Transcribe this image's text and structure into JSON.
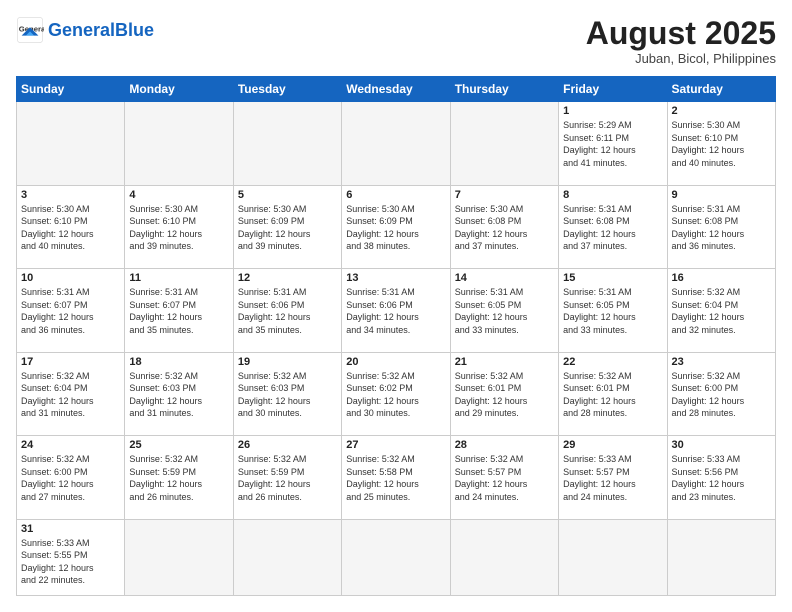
{
  "logo": {
    "text_general": "General",
    "text_blue": "Blue"
  },
  "header": {
    "month": "August 2025",
    "location": "Juban, Bicol, Philippines"
  },
  "weekdays": [
    "Sunday",
    "Monday",
    "Tuesday",
    "Wednesday",
    "Thursday",
    "Friday",
    "Saturday"
  ],
  "weeks": [
    [
      {
        "day": "",
        "info": "",
        "empty": true
      },
      {
        "day": "",
        "info": "",
        "empty": true
      },
      {
        "day": "",
        "info": "",
        "empty": true
      },
      {
        "day": "",
        "info": "",
        "empty": true
      },
      {
        "day": "",
        "info": "",
        "empty": true
      },
      {
        "day": "1",
        "info": "Sunrise: 5:29 AM\nSunset: 6:11 PM\nDaylight: 12 hours\nand 41 minutes."
      },
      {
        "day": "2",
        "info": "Sunrise: 5:30 AM\nSunset: 6:10 PM\nDaylight: 12 hours\nand 40 minutes."
      }
    ],
    [
      {
        "day": "3",
        "info": "Sunrise: 5:30 AM\nSunset: 6:10 PM\nDaylight: 12 hours\nand 40 minutes."
      },
      {
        "day": "4",
        "info": "Sunrise: 5:30 AM\nSunset: 6:10 PM\nDaylight: 12 hours\nand 39 minutes."
      },
      {
        "day": "5",
        "info": "Sunrise: 5:30 AM\nSunset: 6:09 PM\nDaylight: 12 hours\nand 39 minutes."
      },
      {
        "day": "6",
        "info": "Sunrise: 5:30 AM\nSunset: 6:09 PM\nDaylight: 12 hours\nand 38 minutes."
      },
      {
        "day": "7",
        "info": "Sunrise: 5:30 AM\nSunset: 6:08 PM\nDaylight: 12 hours\nand 37 minutes."
      },
      {
        "day": "8",
        "info": "Sunrise: 5:31 AM\nSunset: 6:08 PM\nDaylight: 12 hours\nand 37 minutes."
      },
      {
        "day": "9",
        "info": "Sunrise: 5:31 AM\nSunset: 6:08 PM\nDaylight: 12 hours\nand 36 minutes."
      }
    ],
    [
      {
        "day": "10",
        "info": "Sunrise: 5:31 AM\nSunset: 6:07 PM\nDaylight: 12 hours\nand 36 minutes."
      },
      {
        "day": "11",
        "info": "Sunrise: 5:31 AM\nSunset: 6:07 PM\nDaylight: 12 hours\nand 35 minutes."
      },
      {
        "day": "12",
        "info": "Sunrise: 5:31 AM\nSunset: 6:06 PM\nDaylight: 12 hours\nand 35 minutes."
      },
      {
        "day": "13",
        "info": "Sunrise: 5:31 AM\nSunset: 6:06 PM\nDaylight: 12 hours\nand 34 minutes."
      },
      {
        "day": "14",
        "info": "Sunrise: 5:31 AM\nSunset: 6:05 PM\nDaylight: 12 hours\nand 33 minutes."
      },
      {
        "day": "15",
        "info": "Sunrise: 5:31 AM\nSunset: 6:05 PM\nDaylight: 12 hours\nand 33 minutes."
      },
      {
        "day": "16",
        "info": "Sunrise: 5:32 AM\nSunset: 6:04 PM\nDaylight: 12 hours\nand 32 minutes."
      }
    ],
    [
      {
        "day": "17",
        "info": "Sunrise: 5:32 AM\nSunset: 6:04 PM\nDaylight: 12 hours\nand 31 minutes."
      },
      {
        "day": "18",
        "info": "Sunrise: 5:32 AM\nSunset: 6:03 PM\nDaylight: 12 hours\nand 31 minutes."
      },
      {
        "day": "19",
        "info": "Sunrise: 5:32 AM\nSunset: 6:03 PM\nDaylight: 12 hours\nand 30 minutes."
      },
      {
        "day": "20",
        "info": "Sunrise: 5:32 AM\nSunset: 6:02 PM\nDaylight: 12 hours\nand 30 minutes."
      },
      {
        "day": "21",
        "info": "Sunrise: 5:32 AM\nSunset: 6:01 PM\nDaylight: 12 hours\nand 29 minutes."
      },
      {
        "day": "22",
        "info": "Sunrise: 5:32 AM\nSunset: 6:01 PM\nDaylight: 12 hours\nand 28 minutes."
      },
      {
        "day": "23",
        "info": "Sunrise: 5:32 AM\nSunset: 6:00 PM\nDaylight: 12 hours\nand 28 minutes."
      }
    ],
    [
      {
        "day": "24",
        "info": "Sunrise: 5:32 AM\nSunset: 6:00 PM\nDaylight: 12 hours\nand 27 minutes."
      },
      {
        "day": "25",
        "info": "Sunrise: 5:32 AM\nSunset: 5:59 PM\nDaylight: 12 hours\nand 26 minutes."
      },
      {
        "day": "26",
        "info": "Sunrise: 5:32 AM\nSunset: 5:59 PM\nDaylight: 12 hours\nand 26 minutes."
      },
      {
        "day": "27",
        "info": "Sunrise: 5:32 AM\nSunset: 5:58 PM\nDaylight: 12 hours\nand 25 minutes."
      },
      {
        "day": "28",
        "info": "Sunrise: 5:32 AM\nSunset: 5:57 PM\nDaylight: 12 hours\nand 24 minutes."
      },
      {
        "day": "29",
        "info": "Sunrise: 5:33 AM\nSunset: 5:57 PM\nDaylight: 12 hours\nand 24 minutes."
      },
      {
        "day": "30",
        "info": "Sunrise: 5:33 AM\nSunset: 5:56 PM\nDaylight: 12 hours\nand 23 minutes."
      }
    ],
    [
      {
        "day": "31",
        "info": "Sunrise: 5:33 AM\nSunset: 5:55 PM\nDaylight: 12 hours\nand 22 minutes.",
        "last": true
      },
      {
        "day": "",
        "info": "",
        "empty": true,
        "last": true
      },
      {
        "day": "",
        "info": "",
        "empty": true,
        "last": true
      },
      {
        "day": "",
        "info": "",
        "empty": true,
        "last": true
      },
      {
        "day": "",
        "info": "",
        "empty": true,
        "last": true
      },
      {
        "day": "",
        "info": "",
        "empty": true,
        "last": true
      },
      {
        "day": "",
        "info": "",
        "empty": true,
        "last": true
      }
    ]
  ]
}
